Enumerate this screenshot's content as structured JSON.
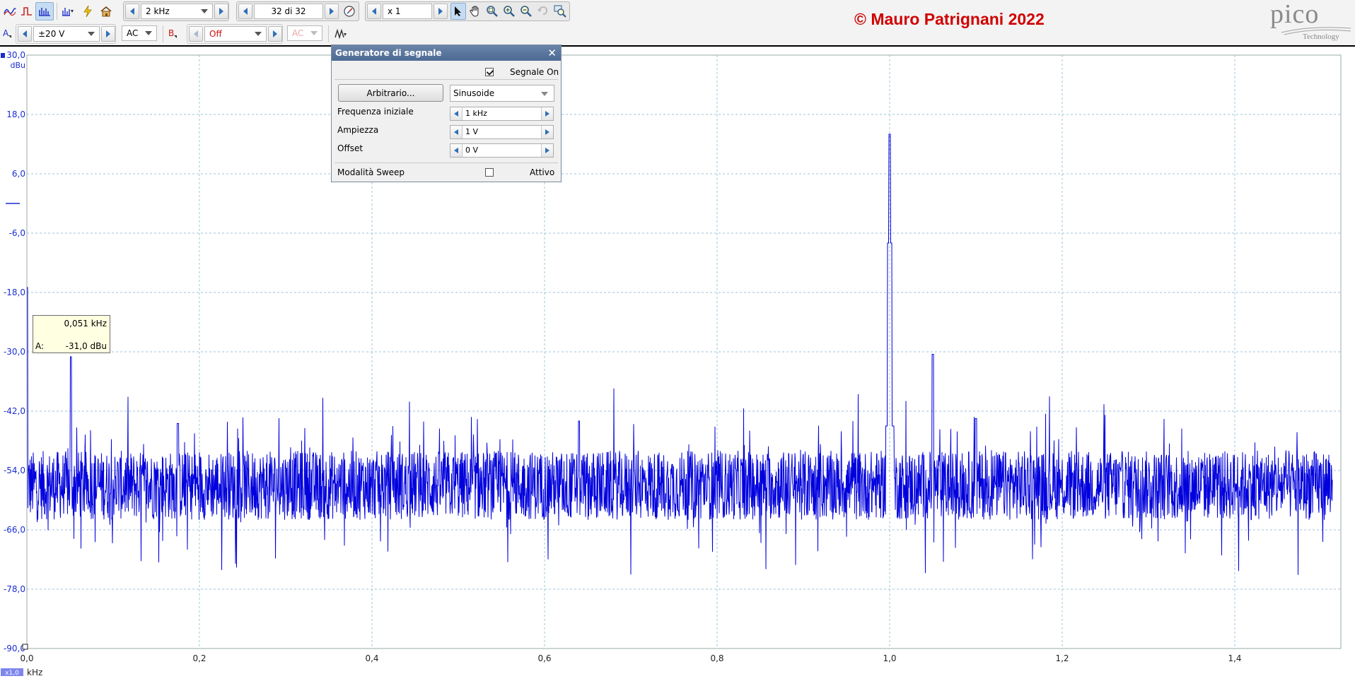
{
  "toolbar_top": {
    "timebase": "2 kHz",
    "buffer": "32 di 32",
    "zoom": "x 1",
    "icons": [
      "scope-mode-icon",
      "persistence-mode-icon",
      "spectrum-mode-icon",
      "spectrum-options-icon",
      "signal-generator-icon",
      "home-icon",
      "pointer-icon",
      "hand-pan-icon",
      "zoom-area-icon",
      "zoom-in-icon",
      "zoom-out-icon",
      "undo-zoom-icon",
      "zoom-overview-icon"
    ]
  },
  "toolbar_channels": {
    "channel_a": {
      "label": "A",
      "range": "±20 V",
      "coupling": "AC"
    },
    "channel_b": {
      "label": "B",
      "range": "Off",
      "coupling": "AC"
    }
  },
  "copyright": "© Mauro Patrignani 2022",
  "logo": {
    "word": "pico",
    "sub": "Technology"
  },
  "signal_generator": {
    "title": "Generatore di segnale",
    "signal_on_label": "Segnale On",
    "signal_on": true,
    "arbitrary_button": "Arbitrario...",
    "waveform": "Sinusoide",
    "start_frequency_label": "Frequenza iniziale",
    "start_frequency": "1 kHz",
    "amplitude_label": "Ampiezza",
    "amplitude": "1 V",
    "offset_label": "Offset",
    "offset": "0 V",
    "sweep_label": "Modalità Sweep",
    "sweep_active_label": "Attivo",
    "sweep_active": false
  },
  "tooltip": {
    "frequency": "0,051 kHz",
    "channel": "A:",
    "level": "-31,0 dBu"
  },
  "chart_data": {
    "type": "line",
    "ylabel": "dBu",
    "xlabel": "kHz",
    "x_scale_badge": "x1,0",
    "ylim": [
      -90,
      30
    ],
    "xlim": [
      0,
      1.53
    ],
    "y_ticks": [
      "30,0",
      "18,0",
      "6,0",
      "-6,0",
      "-18,0",
      "-30,0",
      "-42,0",
      "-54,0",
      "-66,0",
      "-78,0",
      "-90,0"
    ],
    "x_ticks": [
      "0,0",
      "0,2",
      "0,4",
      "0,6",
      "0,8",
      "1,0",
      "1,2",
      "1,4"
    ],
    "grid": true,
    "series": [
      {
        "color": "#0000dd",
        "noise_floor_db": -57,
        "peaks": [
          {
            "x": 0.0,
            "y": -17.0
          },
          {
            "x": 0.051,
            "y": -31.0
          },
          {
            "x": 1.0,
            "y": 14.0
          },
          {
            "x": 1.05,
            "y": -30.5
          },
          {
            "x": 1.1,
            "y": -43.5
          },
          {
            "x": 0.175,
            "y": -44.5
          },
          {
            "x": 0.64,
            "y": -44.0
          }
        ]
      }
    ]
  }
}
